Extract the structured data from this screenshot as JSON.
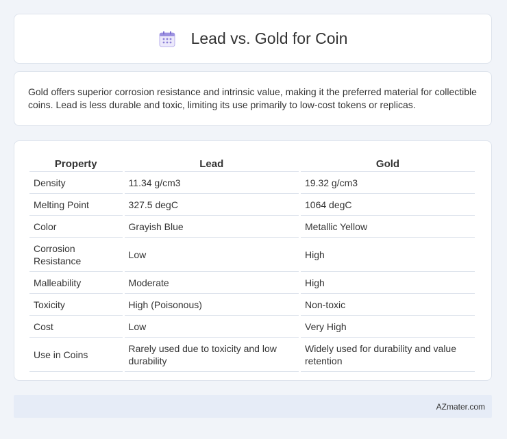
{
  "header": {
    "icon": "calendar-icon",
    "title": "Lead vs. Gold for Coin"
  },
  "summary": {
    "text": "Gold offers superior corrosion resistance and intrinsic value, making it the preferred material for collectible coins. Lead is less durable and toxic, limiting its use primarily to low-cost tokens or replicas."
  },
  "table": {
    "columns": [
      "Property",
      "Lead",
      "Gold"
    ],
    "rows": [
      [
        "Density",
        "11.34 g/cm3",
        "19.32 g/cm3"
      ],
      [
        "Melting Point",
        "327.5 degC",
        "1064 degC"
      ],
      [
        "Color",
        "Grayish Blue",
        "Metallic Yellow"
      ],
      [
        "Corrosion Resistance",
        "Low",
        "High"
      ],
      [
        "Malleability",
        "Moderate",
        "High"
      ],
      [
        "Toxicity",
        "High (Poisonous)",
        "Non-toxic"
      ],
      [
        "Cost",
        "Low",
        "Very High"
      ],
      [
        "Use in Coins",
        "Rarely used due to toxicity and low durability",
        "Widely used for durability and value retention"
      ]
    ]
  },
  "footer": {
    "text": "AZmater.com"
  },
  "colors": {
    "background": "#f1f4f9",
    "card": "#ffffff",
    "border": "#dde3ec",
    "footer": "#e6ecf7",
    "icon_accent": "#8b7fd6"
  }
}
